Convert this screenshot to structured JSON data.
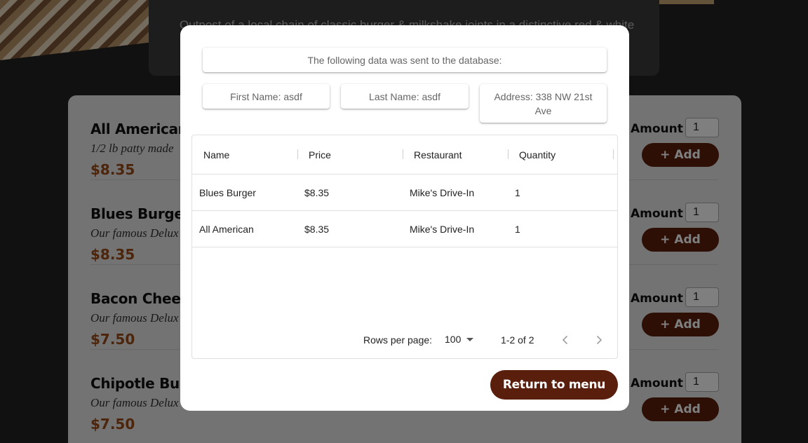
{
  "restaurant": {
    "description": "Outpost of a local chain of classic burger & milkshake joints in a distinctive red & white"
  },
  "menu": {
    "amount_label": "Amount",
    "add_label": "+ Add",
    "items": [
      {
        "name": "All American",
        "desc": "1/2 lb patty made",
        "price": "$8.35",
        "amount": "1"
      },
      {
        "name": "Blues Burger",
        "desc": "Our famous Delux",
        "price": "$8.35",
        "amount": "1"
      },
      {
        "name": "Bacon Cheese",
        "desc": "Our famous Delux",
        "price": "$7.50",
        "amount": "1"
      },
      {
        "name": "Chipotle Burge",
        "desc": "Our famous Delux",
        "price": "$7.50",
        "amount": "1"
      }
    ]
  },
  "modal": {
    "header": "The following data was sent to the database:",
    "first_name": "First Name: asdf",
    "last_name": "Last Name: asdf",
    "address": "Address: 338 NW 21st Ave",
    "columns": [
      "Name",
      "Price",
      "Restaurant",
      "Quantity"
    ],
    "rows": [
      [
        "Blues Burger",
        "$8.35",
        "Mike's Drive-In",
        "1"
      ],
      [
        "All American",
        "$8.35",
        "Mike's Drive-In",
        "1"
      ]
    ],
    "rows_per_page_label": "Rows per page:",
    "rows_per_page_value": "100",
    "page_range": "1-2 of 2",
    "return_label": "Return to menu"
  },
  "icons": {
    "prev": "chevron-left-icon",
    "next": "chevron-right-icon",
    "dropdown": "caret-down-icon"
  },
  "colors": {
    "accent": "#5a1e0c",
    "price": "#9a4a16",
    "background": "#232323"
  }
}
